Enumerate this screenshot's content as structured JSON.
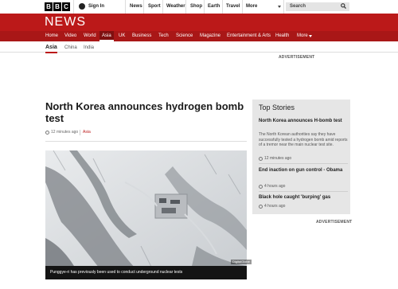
{
  "brand": {
    "letters": [
      "B",
      "B",
      "C"
    ]
  },
  "topbar": {
    "sign_in": "Sign In",
    "nav": [
      "News",
      "Sport",
      "Weather",
      "Shop",
      "Earth",
      "Travel",
      "More"
    ],
    "search_placeholder": "Search"
  },
  "news_header": {
    "title": "NEWS",
    "nav": [
      "Home",
      "Video",
      "World",
      "Asia",
      "UK",
      "Business",
      "Tech",
      "Science",
      "Magazine",
      "Entertainment & Arts",
      "Health",
      "More"
    ],
    "active": "Asia"
  },
  "subnav": {
    "items": [
      "Asia",
      "China",
      "India"
    ],
    "active": "Asia"
  },
  "advertisement_label": "ADVERTISEMENT",
  "article": {
    "headline": "North Korea announces hydrogen bomb test",
    "time": "12 minutes ago",
    "category": "Asia",
    "image_credit": "DigitalGlobe",
    "image_caption": "Punggye-ri has previously been used to conduct underground nuclear tests"
  },
  "top_stories": {
    "title": "Top Stories",
    "items": [
      {
        "title": "North Korea announces H-bomb test",
        "summary": "The North Korean authorities say they have successfully tested a hydrogen bomb amid reports of a tremor near the main nuclear test site.",
        "time": "12 minutes ago"
      },
      {
        "title": "End inaction on gun control - Obama",
        "time": "4 hours ago"
      },
      {
        "title": "Black hole caught 'burping' gas",
        "time": "4 hours ago"
      }
    ]
  },
  "colors": {
    "brand_red": "#bb1919",
    "nav_red": "#a91717",
    "panel_grey": "#e6e6e6"
  }
}
